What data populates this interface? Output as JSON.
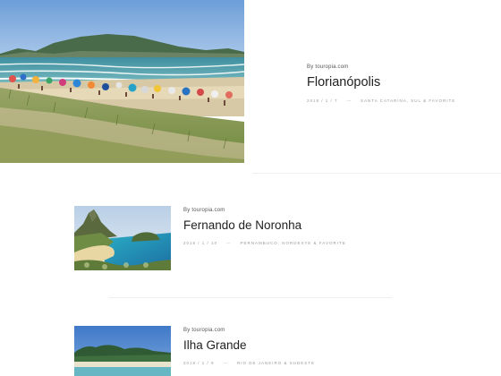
{
  "featured": {
    "byline_prefix": "By",
    "author": "touropia.com",
    "title": "Florianópolis",
    "date": "2018 / 1 / 7",
    "separator": "—",
    "categories": "Santa Catarina, Sul & Favorite"
  },
  "posts": [
    {
      "byline_prefix": "By",
      "author": "touropia.com",
      "title": "Fernando de Noronha",
      "date": "2018 / 1 / 10",
      "separator": "—",
      "categories": "Pernambuco, Nordeste & Favorite"
    },
    {
      "byline_prefix": "By",
      "author": "touropia.com",
      "title": "Ilha Grande",
      "date": "2018 / 1 / 9",
      "separator": "—",
      "categories": "Rio de Janeiro & Sudeste"
    }
  ]
}
